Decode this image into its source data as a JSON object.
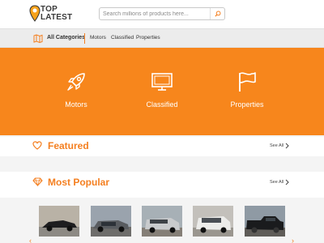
{
  "header": {
    "logo_line1": "TOP",
    "logo_line2": "LATEST",
    "search_placeholder": "Search millions of products here..."
  },
  "category_bar": {
    "all_label": "All Categories",
    "links": [
      "Motors",
      "Classified",
      "Properties"
    ]
  },
  "banner": {
    "tiles": [
      {
        "label": "Motors",
        "icon": "rocket-icon"
      },
      {
        "label": "Classified",
        "icon": "tv-icon"
      },
      {
        "label": "Properties",
        "icon": "flag-icon"
      }
    ]
  },
  "featured": {
    "title": "Featured",
    "see_all": "See All",
    "icon": "heart-icon"
  },
  "popular": {
    "title": "Most Popular",
    "see_all": "See All",
    "icon": "diamond-icon"
  },
  "thumbnails": [
    {
      "name": "black-sports-car-thumb"
    },
    {
      "name": "grey-sedan-thumb"
    },
    {
      "name": "silver-suv-thumb"
    },
    {
      "name": "white-minivan-thumb"
    },
    {
      "name": "black-pickup-truck-thumb"
    }
  ],
  "colors": {
    "accent": "#f7861c",
    "accent_text": "#f47f20",
    "header_bg": "#ffffff",
    "bar_bg": "#ececec"
  }
}
